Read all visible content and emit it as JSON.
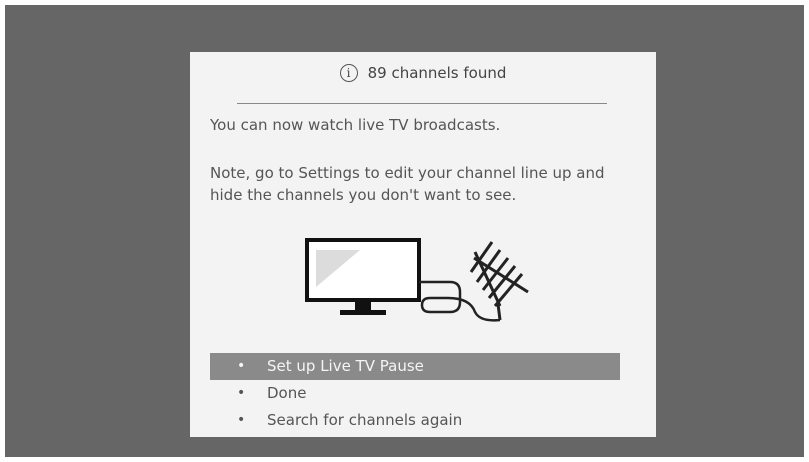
{
  "dialog": {
    "header": {
      "icon": "info-icon",
      "icon_glyph": "i",
      "title": "89 channels found"
    },
    "message_1": "You can now watch live TV broadcasts.",
    "message_2": "Note, go to Settings to edit your channel line up and hide the channels you don't want to see.",
    "illustration": {
      "icons": [
        "tv-icon",
        "antenna-icon"
      ]
    },
    "menu": {
      "bullet": "•",
      "items": [
        {
          "label": "Set up Live TV Pause",
          "selected": true
        },
        {
          "label": "Done",
          "selected": false
        },
        {
          "label": "Search for channels again",
          "selected": false
        }
      ]
    }
  },
  "colors": {
    "screen_bg": "#666666",
    "dialog_bg": "#f3f3f3",
    "selected_bg": "#8a8a8a"
  }
}
